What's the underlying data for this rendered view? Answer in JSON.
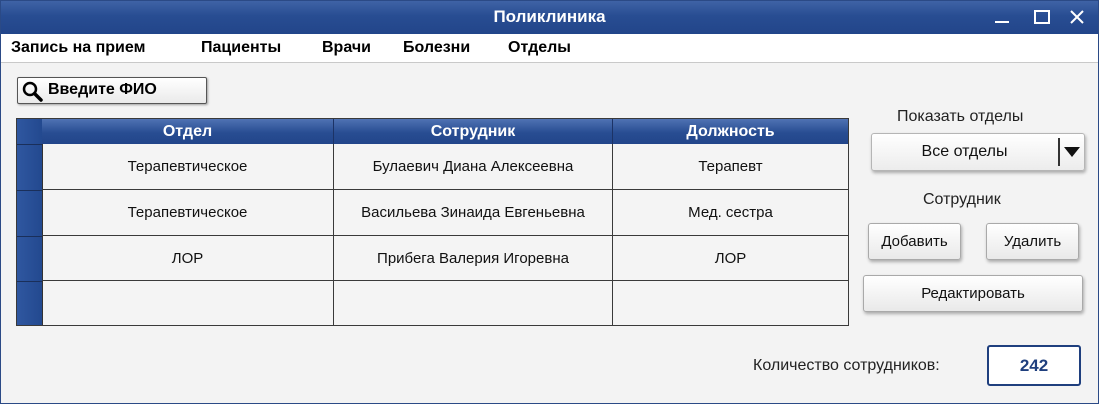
{
  "window": {
    "title": "Поликлиника"
  },
  "menu": [
    "Запись на прием",
    "Пациенты",
    "Врачи",
    "Болезни",
    "Отделы"
  ],
  "search": {
    "label": "Введите ФИО"
  },
  "table": {
    "columns": [
      "Отдел",
      "Сотрудник",
      "Должность"
    ],
    "rows": [
      [
        "Терапевтическое",
        "Булаевич Диана Алексеевна",
        "Терапевт"
      ],
      [
        "Терапевтическое",
        "Васильева Зинаида Евгеньевна",
        "Мед. сестра"
      ],
      [
        "ЛОР",
        "Прибега Валерия Игоревна",
        "ЛОР"
      ],
      [
        "",
        "",
        ""
      ]
    ]
  },
  "filter": {
    "label": "Показать отделы",
    "selected": "Все отделы"
  },
  "employee": {
    "label": "Сотрудник",
    "add": "Добавить",
    "delete": "Удалить",
    "edit": "Редактировать"
  },
  "count": {
    "label": "Количество сотрудников:",
    "value": "242"
  },
  "colors": {
    "accent": "#284d92",
    "background": "#f3f3f3"
  }
}
